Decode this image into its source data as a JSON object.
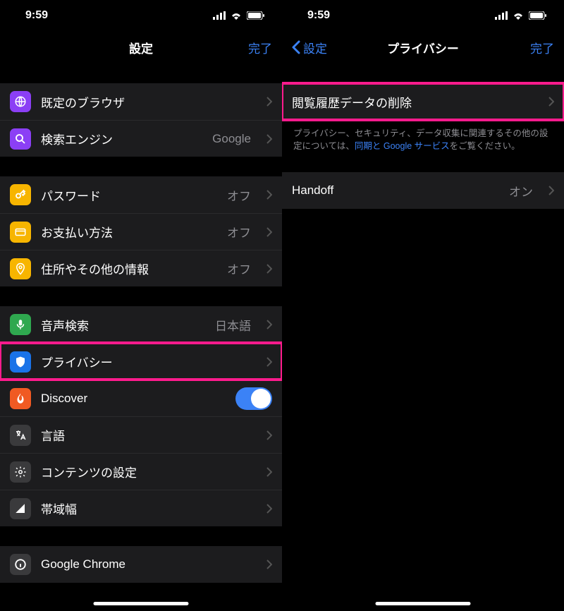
{
  "statusBar": {
    "time": "9:59"
  },
  "left": {
    "nav": {
      "title": "設定",
      "done": "完了"
    },
    "rows": {
      "defaultBrowser": {
        "label": "既定のブラウザ",
        "icon": "globe-icon",
        "bg": "#8b3ff5"
      },
      "searchEngine": {
        "label": "検索エンジン",
        "value": "Google",
        "icon": "search-icon",
        "bg": "#8b3ff5"
      },
      "passwords": {
        "label": "パスワード",
        "value": "オフ",
        "icon": "key-icon",
        "bg": "#f7b500"
      },
      "payment": {
        "label": "お支払い方法",
        "value": "オフ",
        "icon": "card-icon",
        "bg": "#f7b500"
      },
      "addresses": {
        "label": "住所やその他の情報",
        "value": "オフ",
        "icon": "location-icon",
        "bg": "#f7b500"
      },
      "voiceSearch": {
        "label": "音声検索",
        "value": "日本語",
        "icon": "mic-icon",
        "bg": "#2fa84f"
      },
      "privacy": {
        "label": "プライバシー",
        "icon": "shield-icon",
        "bg": "#1a73e8"
      },
      "discover": {
        "label": "Discover",
        "icon": "flame-icon",
        "bg": "#f05a23"
      },
      "language": {
        "label": "言語",
        "icon": "translate-icon",
        "bg": "#3a3a3c"
      },
      "contentSettings": {
        "label": "コンテンツの設定",
        "icon": "gear-icon",
        "bg": "#3a3a3c"
      },
      "bandwidth": {
        "label": "帯域幅",
        "icon": "bandwidth-icon",
        "bg": "#3a3a3c"
      },
      "chrome": {
        "label": "Google Chrome",
        "icon": "info-icon",
        "bg": "#3a3a3c"
      }
    }
  },
  "right": {
    "nav": {
      "back": "設定",
      "title": "プライバシー",
      "done": "完了"
    },
    "rows": {
      "clearData": {
        "label": "閲覧履歴データの削除"
      },
      "handoff": {
        "label": "Handoff",
        "value": "オン"
      }
    },
    "footer": {
      "pre": "プライバシー、セキュリティ、データ収集に関連するその他の設定については、",
      "link": "同期と Google サービス",
      "post": "をご覧ください。"
    }
  }
}
